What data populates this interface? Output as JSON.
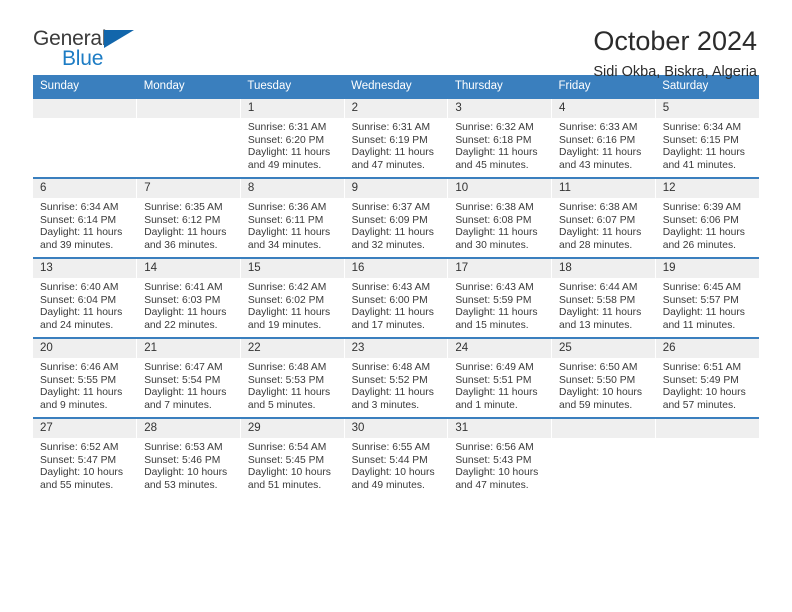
{
  "brand": {
    "name_part1": "General",
    "name_part2": "Blue",
    "accent_color": "#1266ab",
    "text_color": "#3b3b3b"
  },
  "header": {
    "title": "October 2024",
    "subtitle": "Sidi Okba, Biskra, Algeria",
    "header_bg": "#3a7fbe",
    "daynum_bg": "#efefef"
  },
  "weekdays": [
    "Sunday",
    "Monday",
    "Tuesday",
    "Wednesday",
    "Thursday",
    "Friday",
    "Saturday"
  ],
  "labels": {
    "sunrise_prefix": "Sunrise:",
    "sunset_prefix": "Sunset:",
    "daylight_prefix": "Daylight:"
  },
  "weeks": [
    [
      {
        "day": "",
        "lines": []
      },
      {
        "day": "",
        "lines": []
      },
      {
        "day": "1",
        "lines": [
          "Sunrise: 6:31 AM",
          "Sunset: 6:20 PM",
          "Daylight: 11 hours",
          "and 49 minutes."
        ]
      },
      {
        "day": "2",
        "lines": [
          "Sunrise: 6:31 AM",
          "Sunset: 6:19 PM",
          "Daylight: 11 hours",
          "and 47 minutes."
        ]
      },
      {
        "day": "3",
        "lines": [
          "Sunrise: 6:32 AM",
          "Sunset: 6:18 PM",
          "Daylight: 11 hours",
          "and 45 minutes."
        ]
      },
      {
        "day": "4",
        "lines": [
          "Sunrise: 6:33 AM",
          "Sunset: 6:16 PM",
          "Daylight: 11 hours",
          "and 43 minutes."
        ]
      },
      {
        "day": "5",
        "lines": [
          "Sunrise: 6:34 AM",
          "Sunset: 6:15 PM",
          "Daylight: 11 hours",
          "and 41 minutes."
        ]
      }
    ],
    [
      {
        "day": "6",
        "lines": [
          "Sunrise: 6:34 AM",
          "Sunset: 6:14 PM",
          "Daylight: 11 hours",
          "and 39 minutes."
        ]
      },
      {
        "day": "7",
        "lines": [
          "Sunrise: 6:35 AM",
          "Sunset: 6:12 PM",
          "Daylight: 11 hours",
          "and 36 minutes."
        ]
      },
      {
        "day": "8",
        "lines": [
          "Sunrise: 6:36 AM",
          "Sunset: 6:11 PM",
          "Daylight: 11 hours",
          "and 34 minutes."
        ]
      },
      {
        "day": "9",
        "lines": [
          "Sunrise: 6:37 AM",
          "Sunset: 6:09 PM",
          "Daylight: 11 hours",
          "and 32 minutes."
        ]
      },
      {
        "day": "10",
        "lines": [
          "Sunrise: 6:38 AM",
          "Sunset: 6:08 PM",
          "Daylight: 11 hours",
          "and 30 minutes."
        ]
      },
      {
        "day": "11",
        "lines": [
          "Sunrise: 6:38 AM",
          "Sunset: 6:07 PM",
          "Daylight: 11 hours",
          "and 28 minutes."
        ]
      },
      {
        "day": "12",
        "lines": [
          "Sunrise: 6:39 AM",
          "Sunset: 6:06 PM",
          "Daylight: 11 hours",
          "and 26 minutes."
        ]
      }
    ],
    [
      {
        "day": "13",
        "lines": [
          "Sunrise: 6:40 AM",
          "Sunset: 6:04 PM",
          "Daylight: 11 hours",
          "and 24 minutes."
        ]
      },
      {
        "day": "14",
        "lines": [
          "Sunrise: 6:41 AM",
          "Sunset: 6:03 PM",
          "Daylight: 11 hours",
          "and 22 minutes."
        ]
      },
      {
        "day": "15",
        "lines": [
          "Sunrise: 6:42 AM",
          "Sunset: 6:02 PM",
          "Daylight: 11 hours",
          "and 19 minutes."
        ]
      },
      {
        "day": "16",
        "lines": [
          "Sunrise: 6:43 AM",
          "Sunset: 6:00 PM",
          "Daylight: 11 hours",
          "and 17 minutes."
        ]
      },
      {
        "day": "17",
        "lines": [
          "Sunrise: 6:43 AM",
          "Sunset: 5:59 PM",
          "Daylight: 11 hours",
          "and 15 minutes."
        ]
      },
      {
        "day": "18",
        "lines": [
          "Sunrise: 6:44 AM",
          "Sunset: 5:58 PM",
          "Daylight: 11 hours",
          "and 13 minutes."
        ]
      },
      {
        "day": "19",
        "lines": [
          "Sunrise: 6:45 AM",
          "Sunset: 5:57 PM",
          "Daylight: 11 hours",
          "and 11 minutes."
        ]
      }
    ],
    [
      {
        "day": "20",
        "lines": [
          "Sunrise: 6:46 AM",
          "Sunset: 5:55 PM",
          "Daylight: 11 hours",
          "and 9 minutes."
        ]
      },
      {
        "day": "21",
        "lines": [
          "Sunrise: 6:47 AM",
          "Sunset: 5:54 PM",
          "Daylight: 11 hours",
          "and 7 minutes."
        ]
      },
      {
        "day": "22",
        "lines": [
          "Sunrise: 6:48 AM",
          "Sunset: 5:53 PM",
          "Daylight: 11 hours",
          "and 5 minutes."
        ]
      },
      {
        "day": "23",
        "lines": [
          "Sunrise: 6:48 AM",
          "Sunset: 5:52 PM",
          "Daylight: 11 hours",
          "and 3 minutes."
        ]
      },
      {
        "day": "24",
        "lines": [
          "Sunrise: 6:49 AM",
          "Sunset: 5:51 PM",
          "Daylight: 11 hours",
          "and 1 minute."
        ]
      },
      {
        "day": "25",
        "lines": [
          "Sunrise: 6:50 AM",
          "Sunset: 5:50 PM",
          "Daylight: 10 hours",
          "and 59 minutes."
        ]
      },
      {
        "day": "26",
        "lines": [
          "Sunrise: 6:51 AM",
          "Sunset: 5:49 PM",
          "Daylight: 10 hours",
          "and 57 minutes."
        ]
      }
    ],
    [
      {
        "day": "27",
        "lines": [
          "Sunrise: 6:52 AM",
          "Sunset: 5:47 PM",
          "Daylight: 10 hours",
          "and 55 minutes."
        ]
      },
      {
        "day": "28",
        "lines": [
          "Sunrise: 6:53 AM",
          "Sunset: 5:46 PM",
          "Daylight: 10 hours",
          "and 53 minutes."
        ]
      },
      {
        "day": "29",
        "lines": [
          "Sunrise: 6:54 AM",
          "Sunset: 5:45 PM",
          "Daylight: 10 hours",
          "and 51 minutes."
        ]
      },
      {
        "day": "30",
        "lines": [
          "Sunrise: 6:55 AM",
          "Sunset: 5:44 PM",
          "Daylight: 10 hours",
          "and 49 minutes."
        ]
      },
      {
        "day": "31",
        "lines": [
          "Sunrise: 6:56 AM",
          "Sunset: 5:43 PM",
          "Daylight: 10 hours",
          "and 47 minutes."
        ]
      },
      {
        "day": "",
        "lines": []
      },
      {
        "day": "",
        "lines": []
      }
    ]
  ]
}
